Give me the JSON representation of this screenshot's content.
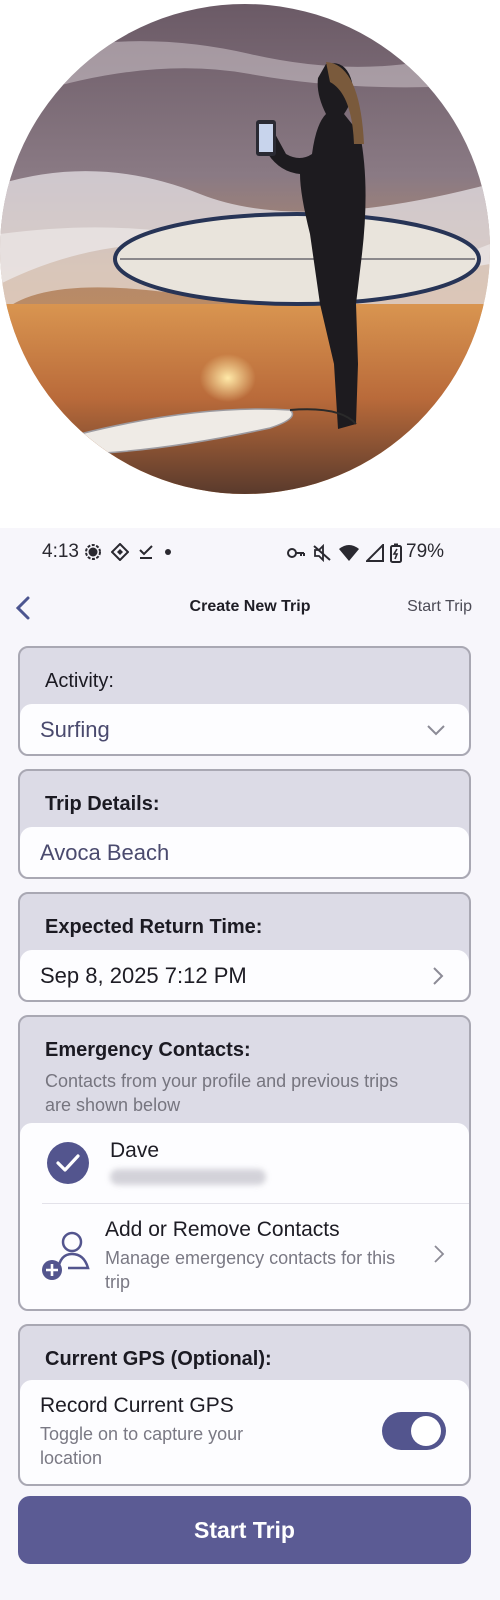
{
  "status_bar": {
    "time": "4:13",
    "battery": "79%",
    "left_icons": [
      "signal-messenger-icon",
      "diamond-icon",
      "check-icon",
      "dot-icon"
    ],
    "right_icons": [
      "key-icon",
      "mute-icon",
      "wifi-icon",
      "cell-signal-icon",
      "battery-charging-icon"
    ]
  },
  "app_bar": {
    "back_icon": "chevron-left-icon",
    "title": "Create New Trip",
    "action": "Start Trip"
  },
  "activity": {
    "label": "Activity:",
    "value": "Surfing",
    "icon": "chevron-down-icon"
  },
  "trip_details": {
    "label": "Trip Details:",
    "value": "Avoca Beach"
  },
  "return_time": {
    "label": "Expected Return Time:",
    "value": "Sep 8, 2025 7:12 PM",
    "icon": "chevron-right-icon"
  },
  "emergency": {
    "label": "Emergency Contacts:",
    "hint": "Contacts from your profile and previous trips are shown below",
    "contacts": [
      {
        "name": "Dave",
        "checked": true
      }
    ],
    "manage": {
      "title": "Add or Remove Contacts",
      "subtitle": "Manage emergency contacts for this trip",
      "icon": "add-person-icon"
    }
  },
  "gps": {
    "label": "Current GPS (Optional):",
    "toggle_title": "Record Current GPS",
    "toggle_subtitle": "Toggle on to capture your location",
    "toggle_on": true
  },
  "start_button": "Start Trip",
  "colors": {
    "accent": "#5b5b94",
    "card_bg": "#dcdbe6",
    "field_bg": "#fdfdff",
    "field_text": "#4a4a6e"
  }
}
